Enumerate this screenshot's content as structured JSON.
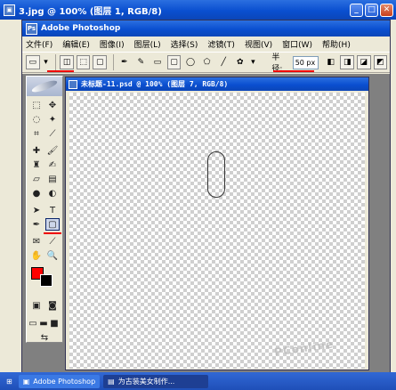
{
  "outer_window": {
    "title": "3.jpg @ 100% (图层 1, RGB/8)"
  },
  "app_window": {
    "title": "Adobe Photoshop"
  },
  "menubar": {
    "items": [
      "文件(F)",
      "编辑(E)",
      "图像(I)",
      "图层(L)",
      "选择(S)",
      "滤镜(T)",
      "视图(V)",
      "窗口(W)",
      "帮助(H)"
    ]
  },
  "options_bar": {
    "radius_label": "半径:",
    "radius_value": "50 px"
  },
  "document": {
    "title": "未标题-11.psd @ 100% (图层 7, RGB/8)"
  },
  "toolbox": {
    "foreground_color": "#ff0000",
    "background_color": "#000000"
  },
  "watermark": {
    "text": "PConline"
  },
  "taskbar": {
    "items": [
      "Adobe Photoshop",
      "为古装美女制作..."
    ]
  },
  "colors": {
    "accent_red": "#e00000",
    "title_blue": "#0a4fd0"
  }
}
